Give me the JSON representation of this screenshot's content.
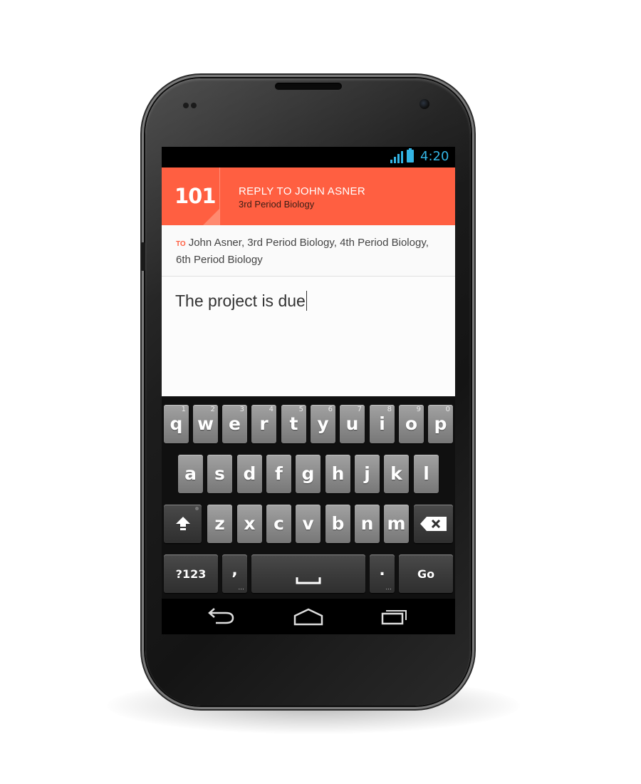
{
  "status_bar": {
    "time": "4:20",
    "signal_icon": "signal-icon",
    "battery_icon": "battery-icon",
    "accent_color": "#33b5e5"
  },
  "app_bar": {
    "logo_text": "101",
    "title": "REPLY TO JOHN ASNER",
    "subtitle": "3rd Period Biology",
    "color": "#ff5f41"
  },
  "recipients": {
    "to_label": "TO",
    "value": "John Asner, 3rd Period Biology, 4th Period Biology, 6th Period Biology"
  },
  "compose": {
    "message": "The project is due"
  },
  "keyboard": {
    "row1": [
      {
        "key": "q",
        "hint": "1"
      },
      {
        "key": "w",
        "hint": "2"
      },
      {
        "key": "e",
        "hint": "3"
      },
      {
        "key": "r",
        "hint": "4"
      },
      {
        "key": "t",
        "hint": "5"
      },
      {
        "key": "y",
        "hint": "6"
      },
      {
        "key": "u",
        "hint": "7"
      },
      {
        "key": "i",
        "hint": "8"
      },
      {
        "key": "o",
        "hint": "9"
      },
      {
        "key": "p",
        "hint": "0"
      }
    ],
    "row2": [
      "a",
      "s",
      "d",
      "f",
      "g",
      "h",
      "j",
      "k",
      "l"
    ],
    "row3": [
      "z",
      "x",
      "c",
      "v",
      "b",
      "n",
      "m"
    ],
    "shift_icon": "shift-icon",
    "backspace_icon": "backspace-icon",
    "symbols_label": "?123",
    "comma_label": ",",
    "space_icon": "space-bar-icon",
    "period_label": ".",
    "go_label": "Go"
  },
  "nav_bar": {
    "back_icon": "back-icon",
    "home_icon": "home-icon",
    "recents_icon": "recent-apps-icon"
  }
}
